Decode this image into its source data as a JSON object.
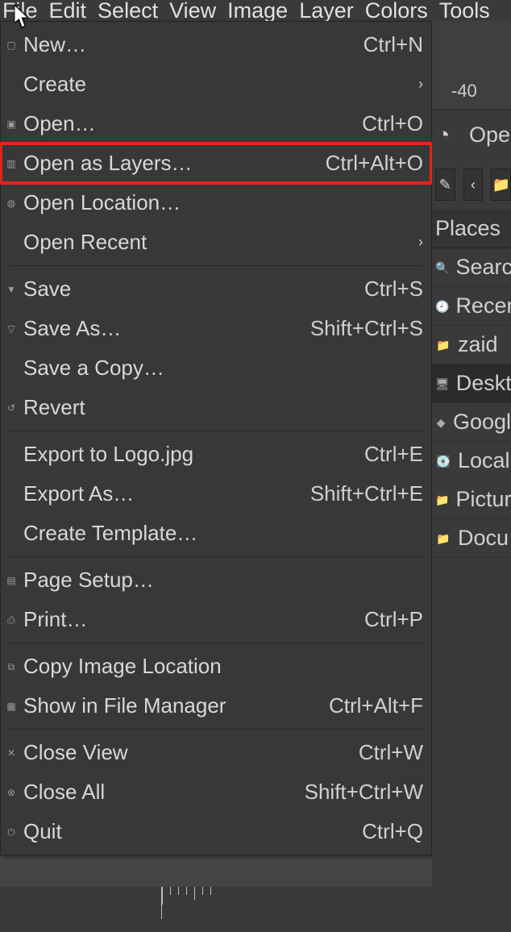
{
  "menubar": {
    "items": [
      "File",
      "Edit",
      "Select",
      "View",
      "Image",
      "Layer",
      "Colors",
      "Tools"
    ],
    "active": 0
  },
  "dropdown": {
    "groups": [
      [
        {
          "icon": "new-icon",
          "label": "New…",
          "accel": "Ctrl+N"
        },
        {
          "icon": "",
          "label": "Create",
          "submenu": true
        },
        {
          "icon": "open-icon",
          "label": "Open…",
          "accel": "Ctrl+O"
        },
        {
          "icon": "open-layers-icon",
          "label": "Open as Layers…",
          "accel": "Ctrl+Alt+O",
          "highlight": true
        },
        {
          "icon": "globe-icon",
          "label": "Open Location…"
        },
        {
          "icon": "",
          "label": "Open Recent",
          "submenu": true
        }
      ],
      [
        {
          "icon": "save-icon",
          "label": "Save",
          "accel": "Ctrl+S"
        },
        {
          "icon": "save-as-icon",
          "label": "Save As…",
          "accel": "Shift+Ctrl+S"
        },
        {
          "icon": "",
          "label": "Save a Copy…"
        },
        {
          "icon": "revert-icon",
          "label": "Revert"
        }
      ],
      [
        {
          "icon": "",
          "label": "Export to Logo.jpg",
          "accel": "Ctrl+E"
        },
        {
          "icon": "",
          "label": "Export As…",
          "accel": "Shift+Ctrl+E"
        },
        {
          "icon": "",
          "label": "Create Template…"
        }
      ],
      [
        {
          "icon": "page-setup-icon",
          "label": "Page Setup…"
        },
        {
          "icon": "print-icon",
          "label": "Print…",
          "accel": "Ctrl+P"
        }
      ],
      [
        {
          "icon": "copy-icon",
          "label": "Copy Image Location"
        },
        {
          "icon": "file-manager-icon",
          "label": "Show in File Manager",
          "accel": "Ctrl+Alt+F"
        }
      ],
      [
        {
          "icon": "close-icon",
          "label": "Close View",
          "accel": "Ctrl+W"
        },
        {
          "icon": "close-all-icon",
          "label": "Close All",
          "accel": "Shift+Ctrl+W"
        },
        {
          "icon": "quit-icon",
          "label": "Quit",
          "accel": "Ctrl+Q"
        }
      ]
    ]
  },
  "ruler": {
    "label": "-40"
  },
  "open_dialog": {
    "wilber": "◔",
    "title_fragment": "Ope",
    "toolbar": {
      "pencil": "✎",
      "chevron_left": "‹",
      "folder": "📁"
    }
  },
  "places": {
    "header": "Places",
    "items": [
      {
        "icon": "search-icon",
        "glyph": "🔍",
        "label": "Searc"
      },
      {
        "icon": "recent-icon",
        "glyph": "🕘",
        "label": "Recen"
      },
      {
        "icon": "home-icon",
        "glyph": "📁",
        "label": "zaid"
      },
      {
        "icon": "desktop-icon",
        "glyph": "🖥",
        "label": "Deskt",
        "selected": true
      },
      {
        "icon": "drive-icon",
        "glyph": "◆",
        "label": "Googl"
      },
      {
        "icon": "disk-icon",
        "glyph": "💽",
        "label": "Local"
      },
      {
        "icon": "pictures-icon",
        "glyph": "📁",
        "label": "Pictur"
      },
      {
        "icon": "documents-icon",
        "glyph": "📁",
        "label": "Docu"
      }
    ]
  }
}
